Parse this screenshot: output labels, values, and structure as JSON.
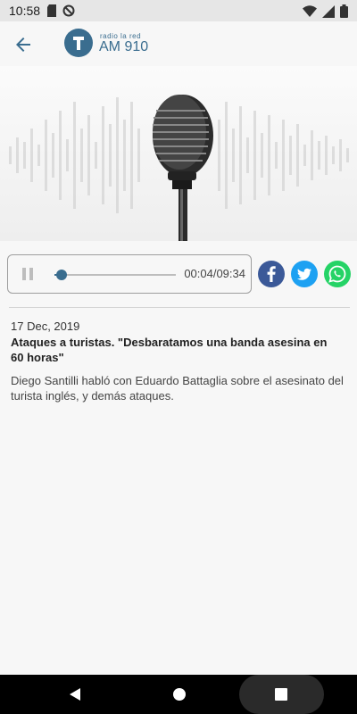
{
  "status_bar": {
    "time": "10:58",
    "left_icons": [
      "sd-card-icon",
      "do-not-disturb-icon"
    ],
    "right_icons": [
      "wifi-icon",
      "signal-icon",
      "battery-icon"
    ]
  },
  "app_bar": {
    "logo_small": "radio la red",
    "logo_big": "AM 910"
  },
  "player": {
    "state": "paused",
    "time": "00:04/09:34",
    "progress": 0.007
  },
  "share": [
    {
      "name": "facebook",
      "color": "#3b5998"
    },
    {
      "name": "twitter",
      "color": "#1da1f2"
    },
    {
      "name": "whatsapp",
      "color": "#25d366"
    }
  ],
  "article": {
    "date": "17 Dec, 2019",
    "title": "Ataques a turistas. \"Desbaratamos una banda asesina en 60 horas\"",
    "description": "Diego Santilli habló con Eduardo Battaglia sobre el asesinato del turista inglés, y demás ataques."
  },
  "colors": {
    "accent": "#3a6d8f",
    "background": "#f7f7f7"
  }
}
